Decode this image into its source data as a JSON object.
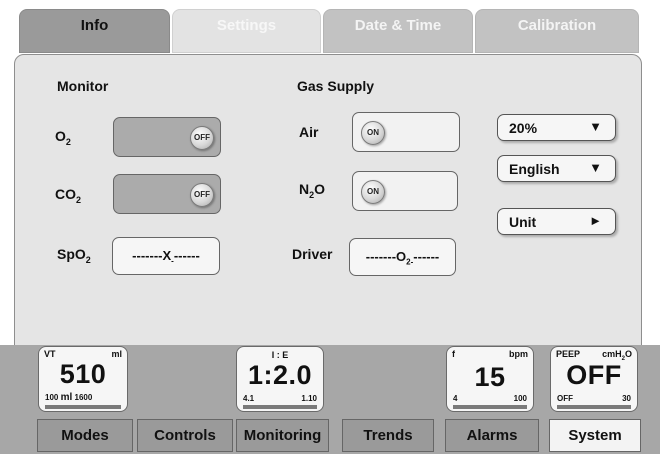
{
  "tabs": [
    {
      "label": "Info"
    },
    {
      "label": "Settings"
    },
    {
      "label": "Date & Time"
    },
    {
      "label": "Calibration"
    }
  ],
  "monitor": {
    "title": "Monitor",
    "o2": {
      "label": "O",
      "sub": "2",
      "state": "OFF"
    },
    "co2": {
      "label": "CO",
      "sub": "2",
      "state": "OFF"
    },
    "spo2": {
      "label": "SpO",
      "sub": "2",
      "value_pre": "-------X",
      "value_sub": "-",
      "value_post": "------"
    }
  },
  "gas_supply": {
    "title": "Gas Supply",
    "air": {
      "label": "Air",
      "state": "ON"
    },
    "n2o": {
      "label_pre": "N",
      "label_sub": "2",
      "label_post": "O",
      "state": "ON"
    },
    "driver": {
      "label": "Driver",
      "value_pre": "-------O",
      "value_sub": "2-",
      "value_post": "------"
    }
  },
  "dropdowns": {
    "o2_percent": {
      "value": "20%",
      "icon": "triangle-down-icon"
    },
    "language": {
      "value": "English",
      "icon": "triangle-down-icon"
    },
    "unit": {
      "value": "Unit",
      "icon": "triangle-right-icon"
    }
  },
  "gauges": {
    "vt": {
      "label": "VT",
      "unit": "ml",
      "value": "510",
      "low": "100",
      "low_unit": "ml",
      "high": "1600"
    },
    "ie": {
      "label": "I : E",
      "value": "1:2.0",
      "low": "4.1",
      "high": "1.10"
    },
    "f": {
      "label": "f",
      "unit": "bpm",
      "value": "15",
      "low": "4",
      "high": "100"
    },
    "peep": {
      "label": "PEEP",
      "unit_pre": "cmH",
      "unit_sub": "2",
      "unit_post": "O",
      "value": "OFF",
      "low": "OFF",
      "high": "30"
    }
  },
  "nav": [
    {
      "label": "Modes"
    },
    {
      "label": "Controls"
    },
    {
      "label": "Monitoring"
    },
    {
      "label": "Trends"
    },
    {
      "label": "Alarms"
    },
    {
      "label": "System"
    }
  ]
}
